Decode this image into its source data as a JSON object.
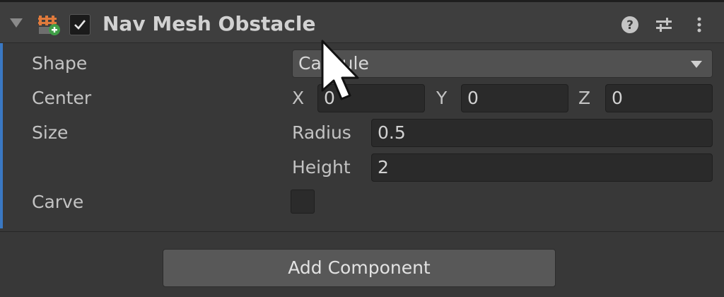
{
  "component": {
    "title": "Nav Mesh Obstacle",
    "enabled": true
  },
  "properties": {
    "shape": {
      "label": "Shape",
      "value": "Capsule"
    },
    "center": {
      "label": "Center",
      "x_label": "X",
      "x_value": "0",
      "y_label": "Y",
      "y_value": "0",
      "z_label": "Z",
      "z_value": "0"
    },
    "size": {
      "label": "Size",
      "radius_label": "Radius",
      "radius_value": "0.5",
      "height_label": "Height",
      "height_value": "2"
    },
    "carve": {
      "label": "Carve",
      "checked": false
    }
  },
  "footer": {
    "add_component_label": "Add Component"
  },
  "icons": {
    "foldout": "triangle-down-icon",
    "component": "nav-mesh-obstacle-icon",
    "help": "help-icon",
    "presets": "presets-sliders-icon",
    "more": "kebab-menu-icon",
    "cursor": "mouse-cursor"
  },
  "colors": {
    "accent": "#3a78c3",
    "panel": "#383838",
    "header": "#3e3e3e"
  }
}
